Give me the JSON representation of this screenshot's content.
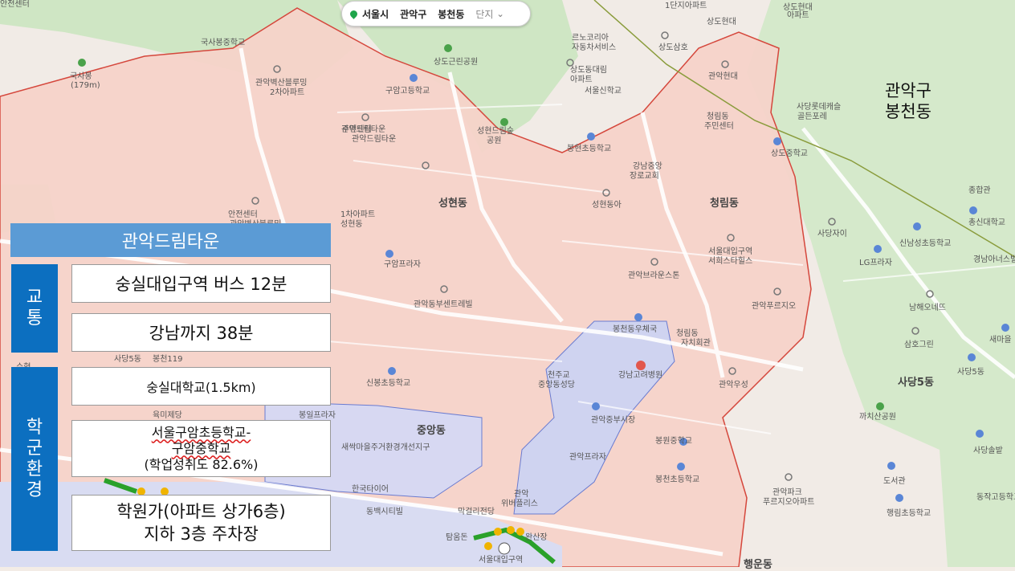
{
  "breadcrumb": {
    "city": "서울시",
    "district": "관악구",
    "dong": "봉천동",
    "mode": "단지"
  },
  "region_label": [
    "관악구",
    "봉천동"
  ],
  "districts": [
    "성현동",
    "청림동",
    "중앙동",
    "사당5동",
    "행운동"
  ],
  "places": [
    "국사봉중학교",
    "국사봉",
    "(179m)",
    "관악벽산블루밍",
    "2차아파트",
    "구암고등학교",
    "상도근린공원",
    "르노코리아",
    "자동차서비스",
    "상도동대림",
    "아파트",
    "서울신학교",
    "상도현대",
    "상도삼호",
    "관악현대",
    "청림동",
    "주민센터",
    "사당롯데캐슬",
    "골든포레",
    "상도중학교",
    "관악드림타운",
    "성현드림숲",
    "공원",
    "봉현초등학교",
    "강남중앙",
    "장로교회",
    "성현동아",
    "구암프라자",
    "관악동부센트레빌",
    "관악브라운스톤",
    "서울대입구역",
    "서희스타힐스",
    "관악푸르지오",
    "봉천동우체국",
    "청림동",
    "자치회관",
    "천주교",
    "중앙동성당",
    "강남고려병원",
    "관악중부시장",
    "신봉초등학교",
    "봉원중학교",
    "관악우성",
    "새싹마을주거환경개선지구",
    "관악프라자",
    "봉천초등학교",
    "한국타이어",
    "막걸리전당",
    "관악",
    "위버플리스",
    "동백시티빌",
    "관악파크",
    "푸르지오아파트",
    "탐움돈",
    "완산장",
    "서울대입구역",
    "종합관",
    "총신대학교",
    "사당자이",
    "신남성초등학교",
    "LG프라자",
    "경남아너스빌",
    "남해오네뜨",
    "새마을",
    "삼호그린",
    "사당5동",
    "까치산공원",
    "사당솔밭",
    "도서관",
    "행림초등학교",
    "동작고등학교",
    "사당5동",
    "봉천119",
    "수협",
    "봉일프라자",
    "육미제당",
    "1단지아파트",
    "상도현대",
    "안전센터",
    "관악벽산블루밍",
    "1차아파트",
    "성현동",
    "주민센터",
    "관악드림타운",
    "아파트",
    "안전센터"
  ],
  "panel": {
    "title": "관악드림타운",
    "transport_label": "교\n통",
    "transport": [
      "숭실대입구역 버스 12분",
      "강남까지 38분"
    ],
    "school_label": "학\n군\n환\n경",
    "school_1": "숭실대학교(1.5km)",
    "school_2": {
      "line1": "서울구암초등학교-",
      "line2": "구암중학교",
      "line3": "(학업성취도 82.6%)"
    },
    "school_3": {
      "line1": "학원가(아파트 상가6층)",
      "line2": "지하 3층 주차장"
    }
  },
  "colors": {
    "zone": "#f7d2c8",
    "border": "#d5473c",
    "blue_zone": "#cfd4f0",
    "green": "#c9e3bd",
    "panel_blue": "#0c6fc0",
    "title_blue": "#5b9bd5"
  }
}
